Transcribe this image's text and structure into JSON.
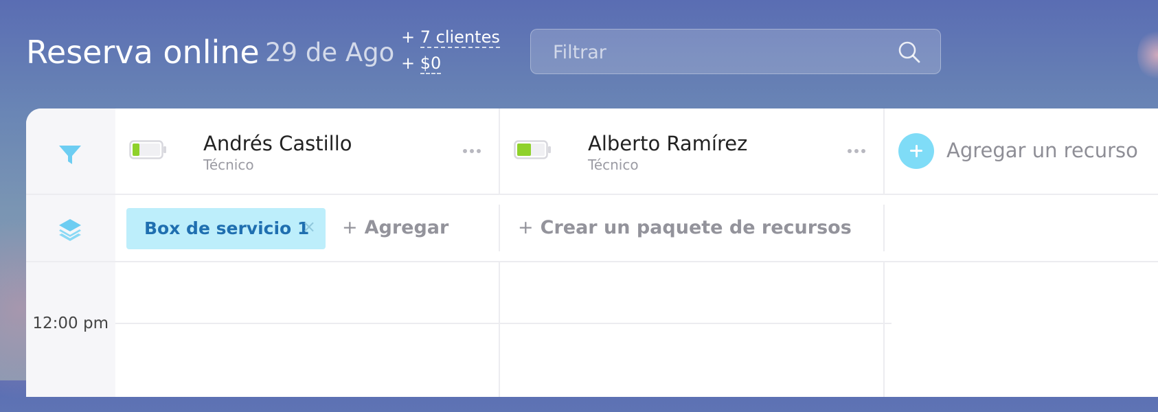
{
  "header": {
    "title": "Reserva online",
    "date": "29 de Ago",
    "stats": [
      {
        "prefix": "+ ",
        "value": "7 clientes"
      },
      {
        "prefix": "+ ",
        "value": "$0"
      }
    ]
  },
  "search": {
    "placeholder": "Filtrar",
    "value": "",
    "icon": "search-icon"
  },
  "resources": [
    {
      "name": "Andrés Castillo",
      "role": "Técnico",
      "battery_level": 0.25,
      "battery_color": "#8fd12b"
    },
    {
      "name": "Alberto Ramírez",
      "role": "Técnico",
      "battery_level": 0.5,
      "battery_color": "#8fd12b"
    }
  ],
  "add_resource": {
    "label": "Agregar un recurso"
  },
  "bundles": {
    "chip": {
      "label": "Box de servicio 1",
      "close": "×"
    },
    "add_label": "Agregar",
    "create_label": "Crear un paquete de recursos",
    "plus": "+"
  },
  "timeline": {
    "time_label": "12:00 pm"
  },
  "colors": {
    "accent": "#7fdcf7",
    "chip_bg": "#bdeefb",
    "chip_text": "#1f6fb0"
  }
}
